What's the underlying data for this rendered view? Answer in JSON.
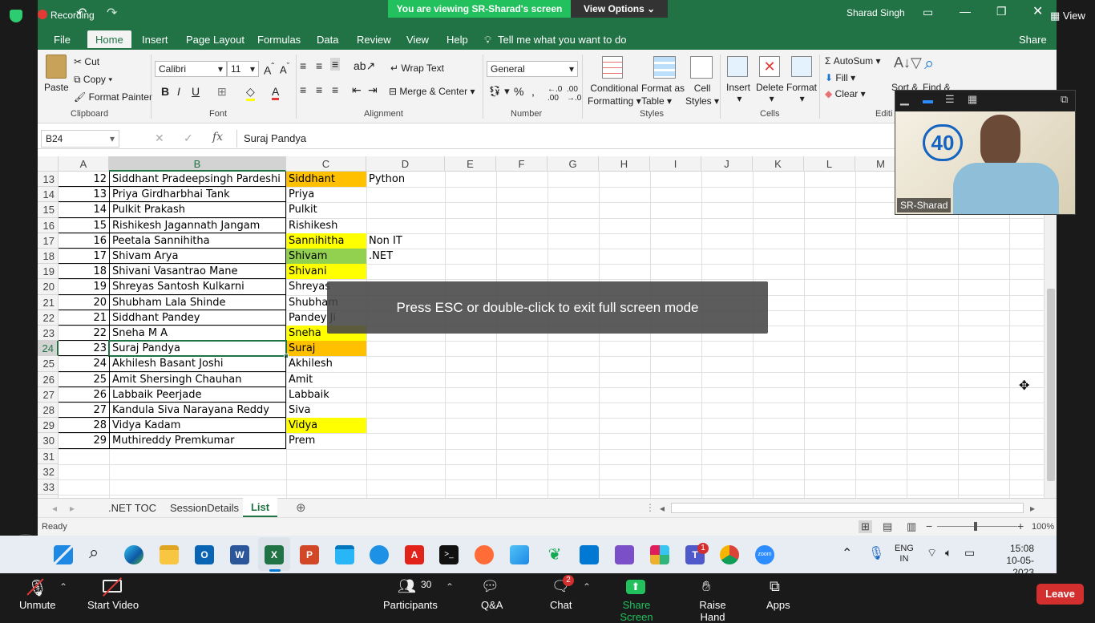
{
  "zoom_top": {
    "recording": "Recording",
    "viewing_banner": "You are viewing SR-Sharad's screen",
    "view_options": "View Options",
    "view": "View"
  },
  "excel": {
    "user": "Sharad Singh",
    "tabs": [
      "File",
      "Home",
      "Insert",
      "Page Layout",
      "Formulas",
      "Data",
      "Review",
      "View",
      "Help"
    ],
    "tell_me": "Tell me what you want to do",
    "share": "Share",
    "clipboard": {
      "paste": "Paste",
      "cut": "Cut",
      "copy": "Copy",
      "format_painter": "Format Painter",
      "label": "Clipboard"
    },
    "font": {
      "name": "Calibri",
      "size": "11",
      "label": "Font"
    },
    "alignment": {
      "wrap": "Wrap Text",
      "merge": "Merge & Center",
      "label": "Alignment"
    },
    "number": {
      "format": "General",
      "label": "Number"
    },
    "styles": {
      "conditional1": "Conditional",
      "conditional2": "Formatting",
      "format_as1": "Format as",
      "format_as2": "Table",
      "cell_styles1": "Cell",
      "cell_styles2": "Styles",
      "label": "Styles"
    },
    "cells": {
      "insert": "Insert",
      "delete": "Delete",
      "format": "Format",
      "label": "Cells"
    },
    "editing": {
      "autosum": "AutoSum",
      "fill": "Fill",
      "clear": "Clear",
      "sort": "Sort &",
      "find": "Find &",
      "label": "Editi"
    },
    "namebox": "B24",
    "formula": "Suraj Pandya",
    "columns": [
      "A",
      "B",
      "C",
      "D",
      "E",
      "F",
      "G",
      "H",
      "I",
      "J",
      "K",
      "L",
      "M"
    ],
    "rows": [
      {
        "r": "13",
        "a": "12",
        "b": "Siddhant Pradeepsingh Pardeshi",
        "c": "Siddhant",
        "cfill": "#ffc000",
        "d": "Python"
      },
      {
        "r": "14",
        "a": "13",
        "b": "Priya Girdharbhai Tank",
        "c": "Priya",
        "cfill": "",
        "d": ""
      },
      {
        "r": "15",
        "a": "14",
        "b": "Pulkit Prakash",
        "c": "Pulkit",
        "cfill": "",
        "d": ""
      },
      {
        "r": "16",
        "a": "15",
        "b": "Rishikesh Jagannath Jangam",
        "c": "Rishikesh",
        "cfill": "",
        "d": ""
      },
      {
        "r": "17",
        "a": "16",
        "b": "Peetala Sannihitha",
        "c": "Sannihitha",
        "cfill": "#ffff00",
        "d": "Non IT"
      },
      {
        "r": "18",
        "a": "17",
        "b": "Shivam Arya",
        "c": "Shivam",
        "cfill": "#92d050",
        "d": ".NET"
      },
      {
        "r": "19",
        "a": "18",
        "b": "Shivani Vasantrao Mane",
        "c": "Shivani",
        "cfill": "#ffff00",
        "d": ""
      },
      {
        "r": "20",
        "a": "19",
        "b": "Shreyas Santosh Kulkarni",
        "c": "Shreyas",
        "cfill": "",
        "d": ""
      },
      {
        "r": "21",
        "a": "20",
        "b": "Shubham Lala Shinde",
        "c": "Shubham",
        "cfill": "",
        "d": ""
      },
      {
        "r": "22",
        "a": "21",
        "b": "Siddhant Pandey",
        "c": "Pandey Ji",
        "cfill": "",
        "d": ""
      },
      {
        "r": "23",
        "a": "22",
        "b": "Sneha M A",
        "c": "Sneha",
        "cfill": "#ffff00",
        "d": ""
      },
      {
        "r": "24",
        "a": "23",
        "b": "Suraj Pandya",
        "c": "Suraj",
        "cfill": "#ffc000",
        "d": ""
      },
      {
        "r": "25",
        "a": "24",
        "b": "Akhilesh Basant Joshi",
        "c": "Akhilesh",
        "cfill": "",
        "d": ""
      },
      {
        "r": "26",
        "a": "25",
        "b": "Amit Shersingh Chauhan",
        "c": "Amit",
        "cfill": "",
        "d": ""
      },
      {
        "r": "27",
        "a": "26",
        "b": "Labbaik Peerjade",
        "c": "Labbaik",
        "cfill": "",
        "d": ""
      },
      {
        "r": "28",
        "a": "27",
        "b": "Kandula Siva Narayana Reddy",
        "c": "Siva",
        "cfill": "",
        "d": ""
      },
      {
        "r": "29",
        "a": "28",
        "b": "Vidya Kadam",
        "c": "Vidya",
        "cfill": "#ffff00",
        "d": ""
      },
      {
        "r": "30",
        "a": "29",
        "b": "Muthireddy Premkumar",
        "c": "Prem",
        "cfill": "",
        "d": ""
      },
      {
        "r": "31",
        "a": "",
        "b": "",
        "c": "",
        "cfill": "",
        "d": ""
      },
      {
        "r": "32",
        "a": "",
        "b": "",
        "c": "",
        "cfill": "",
        "d": ""
      },
      {
        "r": "33",
        "a": "",
        "b": "",
        "c": "",
        "cfill": "",
        "d": ""
      }
    ],
    "sheet_tabs": [
      ".NET TOC",
      "SessionDetails",
      "List"
    ],
    "active_sheet": "List",
    "status": "Ready",
    "zoom": "100%",
    "fullscreen_msg": "Press ESC or double-click to exit full screen mode"
  },
  "video": {
    "name": "SR-Sharad"
  },
  "taskbar": {
    "lang1": "ENG",
    "lang2": "IN",
    "time": "15:08",
    "date": "10-05-2023",
    "teams_badge": "1"
  },
  "zoom_bar": {
    "unmute": "Unmute",
    "start_video": "Start Video",
    "participants": "Participants",
    "participants_count": "30",
    "qa": "Q&A",
    "chat": "Chat",
    "chat_badge": "2",
    "share": "Share Screen",
    "raise": "Raise Hand",
    "apps": "Apps",
    "leave": "Leave"
  },
  "colors": {
    "excel_green": "#217346",
    "zoom_green": "#22c15e",
    "leave_red": "#d32f2f"
  }
}
